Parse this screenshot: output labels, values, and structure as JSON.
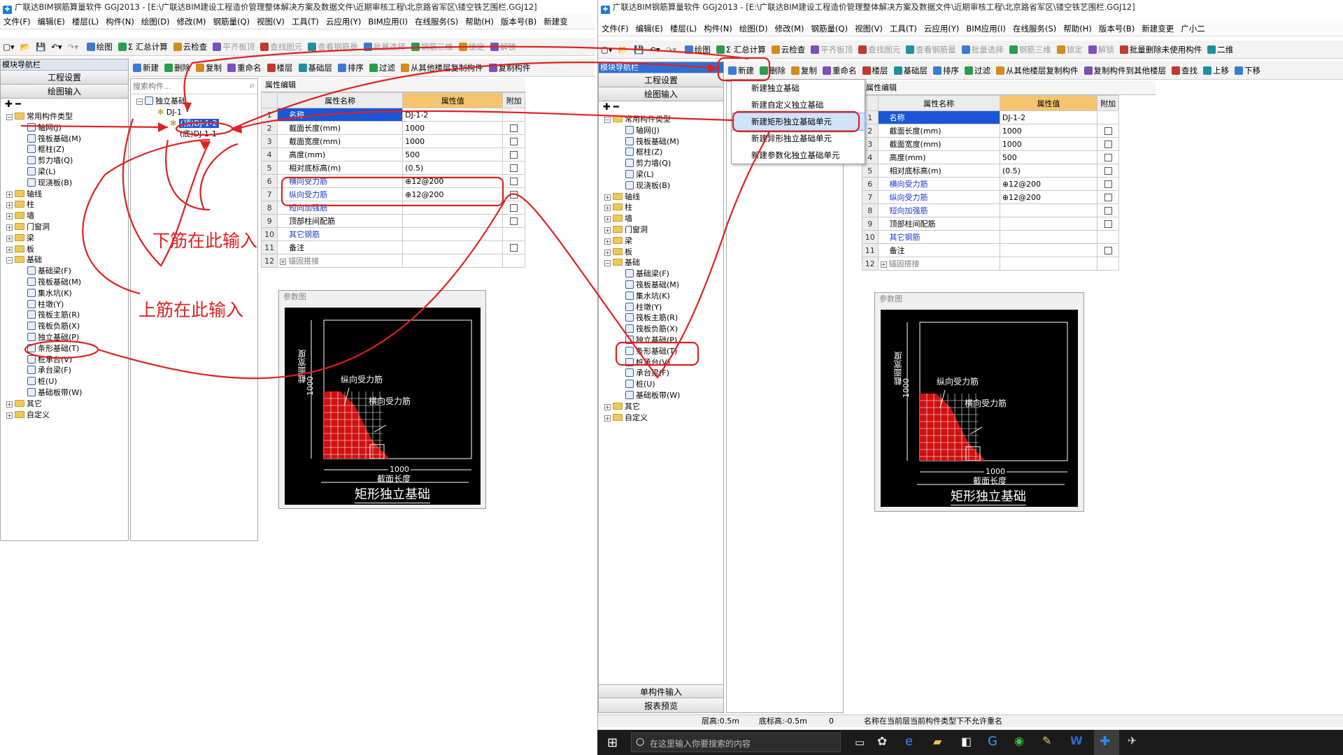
{
  "left_window": {
    "title": "广联达BIM钢筋算量软件 GGJ2013 - [E:\\广联达BIM建设工程造价管理整体解决方案及数据文件\\近期审核工程\\北京路省军区\\镂空铁艺围栏.GGJ12]",
    "menu": [
      "文件(F)",
      "编辑(E)",
      "楼层(L)",
      "构件(N)",
      "绘图(D)",
      "修改(M)",
      "钢筋量(Q)",
      "视图(V)",
      "工具(T)",
      "云应用(Y)",
      "BIM应用(I)",
      "在线服务(S)",
      "帮助(H)",
      "版本号(B)",
      "新建变"
    ],
    "toolbar1": [
      "绘图",
      "Σ 汇总计算",
      "云检查",
      "平齐板顶",
      "查找图元",
      "查看钢筋量",
      "批量选择",
      "钢筋三维",
      "锁定",
      "解锁"
    ],
    "toolbar2": [
      "新建",
      "删除",
      "复制",
      "重命名",
      "楼层",
      "基础层",
      "排序",
      "过滤",
      "从其他楼层复制构件",
      "复制构件"
    ],
    "nav_title": "模块导航栏",
    "nav_buttons": [
      "工程设置",
      "绘图输入"
    ],
    "search_placeholder": "搜索构件...",
    "tree_common": "常用构件类型",
    "tree_common_items": [
      "轴网(J)",
      "筏板基础(M)",
      "框柱(Z)",
      "剪力墙(Q)",
      "梁(L)",
      "现浇板(B)"
    ],
    "tree_groups": [
      "轴线",
      "柱",
      "墙",
      "门窗洞",
      "梁",
      "板"
    ],
    "tree_foundation": "基础",
    "tree_foundation_items": [
      "基础梁(F)",
      "筏板基础(M)",
      "集水坑(K)",
      "柱墩(Y)",
      "筏板主筋(R)",
      "筏板负筋(X)",
      "独立基础(P)",
      "条形基础(T)",
      "桩承台(V)",
      "承台梁(F)",
      "桩(U)",
      "基础板带(W)"
    ],
    "tree_other": [
      "其它",
      "自定义"
    ],
    "comp_root": "独立基础",
    "comp_dj": "DJ-1",
    "comp_top": "(顶)DJ-1-2",
    "comp_bottom": "(底)DJ-1-1",
    "prop_tab": "属性编辑"
  },
  "right_window": {
    "title": "广联达BIM钢筋算量软件 GGJ2013 - [E:\\广联达BIM建设工程造价管理整体解决方案及数据文件\\近期审核工程\\北京路省军区\\镂空铁艺围栏.GGJ12]",
    "menu": [
      "文件(F)",
      "编辑(E)",
      "楼层(L)",
      "构件(N)",
      "绘图(D)",
      "修改(M)",
      "钢筋量(Q)",
      "视图(V)",
      "工具(T)",
      "云应用(Y)",
      "BIM应用(I)",
      "在线服务(S)",
      "帮助(H)",
      "版本号(B)",
      "新建变更",
      "广小二"
    ],
    "toolbar1": [
      "绘图",
      "Σ 汇总计算",
      "云检查",
      "平齐板顶",
      "查找图元",
      "查看钢筋量",
      "批量选择",
      "钢筋三维",
      "锁定",
      "解锁",
      "批量删除未使用构件",
      "二维"
    ],
    "toolbar2": [
      "新建",
      "删除",
      "复制",
      "重命名",
      "楼层",
      "基础层",
      "排序",
      "过滤",
      "从其他楼层复制构件",
      "复制构件到其他楼层",
      "查找",
      "上移",
      "下移"
    ],
    "nav_title": "模块导航栏",
    "nav_buttons": [
      "工程设置",
      "绘图输入"
    ],
    "nav_bottom_buttons": [
      "单构件输入",
      "报表预览"
    ],
    "dropdown": [
      "新建独立基础",
      "新建自定义独立基础",
      "新建矩形独立基础单元",
      "新建异形独立基础单元",
      "新建参数化独立基础单元"
    ],
    "prop_tab": "属性编辑",
    "status": {
      "floor_height": "层高:0.5m",
      "bottom_elev": "底标高:-0.5m",
      "zero": "0",
      "message": "名称在当前层当前构件类型下不允许重名"
    },
    "taskbar_search": "在这里输入你要搜索的内容"
  },
  "props_left": {
    "col_name": "属性名称",
    "col_value": "属性值",
    "col_extra": "附加",
    "rows": [
      {
        "n": "1",
        "name": "名称",
        "value": "DJ-1-2",
        "check": false,
        "style": "sel"
      },
      {
        "n": "2",
        "name": "截面长度(mm)",
        "value": "1000",
        "check": true,
        "style": ""
      },
      {
        "n": "3",
        "name": "截面宽度(mm)",
        "value": "1000",
        "check": true,
        "style": ""
      },
      {
        "n": "4",
        "name": "高度(mm)",
        "value": "500",
        "check": true,
        "style": ""
      },
      {
        "n": "5",
        "name": "相对底标高(m)",
        "value": "(0.5)",
        "check": true,
        "style": ""
      },
      {
        "n": "6",
        "name": "横向受力筋",
        "value": "⊕12@200",
        "check": true,
        "style": "blue"
      },
      {
        "n": "7",
        "name": "纵向受力筋",
        "value": "⊕12@200",
        "check": true,
        "style": "blue"
      },
      {
        "n": "8",
        "name": "短向加强筋",
        "value": "",
        "check": true,
        "style": "blue"
      },
      {
        "n": "9",
        "name": "顶部柱间配筋",
        "value": "",
        "check": true,
        "style": ""
      },
      {
        "n": "10",
        "name": "其它钢筋",
        "value": "",
        "check": false,
        "style": "blue"
      },
      {
        "n": "11",
        "name": "备注",
        "value": "",
        "check": true,
        "style": ""
      },
      {
        "n": "12",
        "name": "锚固搭接",
        "value": "",
        "check": false,
        "style": "gray"
      }
    ]
  },
  "props_right": {
    "col_name": "属性名称",
    "col_value": "属性值",
    "col_extra": "附加",
    "rows": [
      {
        "n": "1",
        "name": "名称",
        "value": "DJ-1-2",
        "check": false,
        "style": "sel"
      },
      {
        "n": "2",
        "name": "截面长度(mm)",
        "value": "1000",
        "check": true,
        "style": ""
      },
      {
        "n": "3",
        "name": "截面宽度(mm)",
        "value": "1000",
        "check": true,
        "style": ""
      },
      {
        "n": "4",
        "name": "高度(mm)",
        "value": "500",
        "check": true,
        "style": ""
      },
      {
        "n": "5",
        "name": "相对底标高(m)",
        "value": "(0.5)",
        "check": true,
        "style": ""
      },
      {
        "n": "6",
        "name": "横向受力筋",
        "value": "⊕12@200",
        "check": true,
        "style": "blue"
      },
      {
        "n": "7",
        "name": "纵向受力筋",
        "value": "⊕12@200",
        "check": true,
        "style": "blue"
      },
      {
        "n": "8",
        "name": "短向加强筋",
        "value": "",
        "check": true,
        "style": "blue"
      },
      {
        "n": "9",
        "name": "顶部柱间配筋",
        "value": "",
        "check": true,
        "style": ""
      },
      {
        "n": "10",
        "name": "其它钢筋",
        "value": "",
        "check": false,
        "style": "blue"
      },
      {
        "n": "11",
        "name": "备注",
        "value": "",
        "check": true,
        "style": ""
      },
      {
        "n": "12",
        "name": "锚固搭接",
        "value": "",
        "check": false,
        "style": "gray"
      }
    ]
  },
  "diagram": {
    "header": "参数图",
    "width_label": "截面宽度",
    "width_value": "1000",
    "length_label": "截面长度",
    "length_value": "1000",
    "long_bar": "纵向受力筋",
    "trans_bar": "横向受力筋",
    "caption": "矩形独立基础"
  },
  "annotations": {
    "bottom_rebar": "下筋在此输入",
    "top_rebar": "上筋在此输入"
  },
  "colors": {
    "annotation": "#e0201e",
    "selected": "#1a56d6",
    "value_header": "#f4c56e"
  }
}
